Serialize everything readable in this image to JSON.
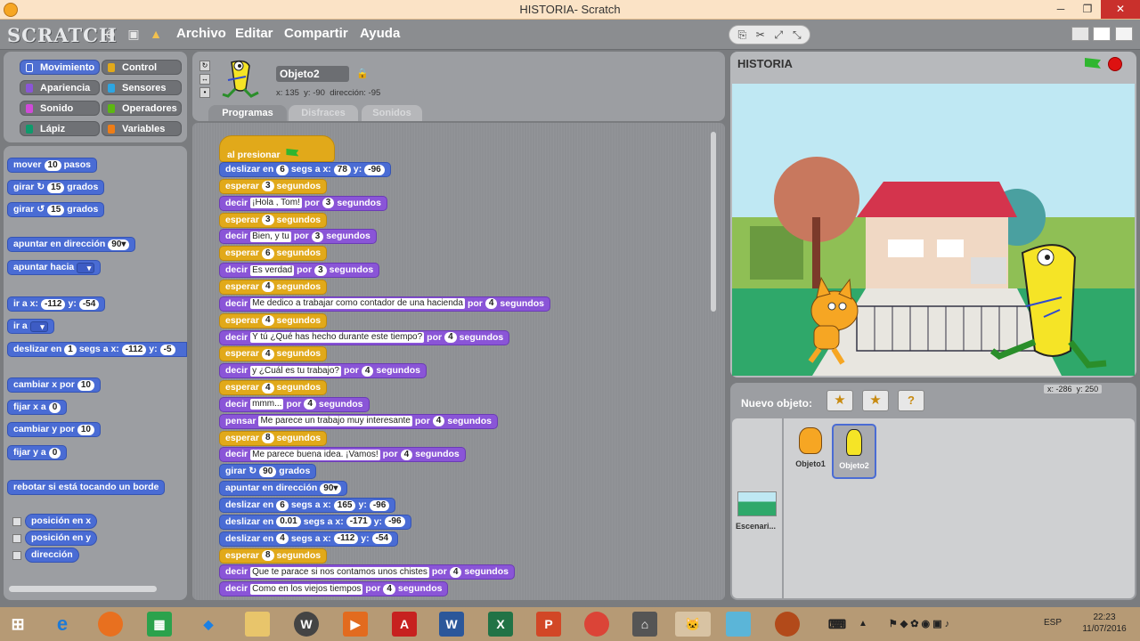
{
  "window": {
    "title": "HISTORIA- Scratch"
  },
  "menu": {
    "logo": "SCRATCH",
    "items": [
      "Archivo",
      "Editar",
      "Compartir",
      "Ayuda"
    ]
  },
  "categories": [
    {
      "label": "Movimiento",
      "color": "#4a6cd4",
      "selected": true
    },
    {
      "label": "Control",
      "color": "#e1a91a",
      "selected": false
    },
    {
      "label": "Apariencia",
      "color": "#8a55d7",
      "selected": false
    },
    {
      "label": "Sensores",
      "color": "#2ca5e2",
      "selected": false
    },
    {
      "label": "Sonido",
      "color": "#cf4ad9",
      "selected": false
    },
    {
      "label": "Operadores",
      "color": "#5cb712",
      "selected": false
    },
    {
      "label": "Lápiz",
      "color": "#0e9a6c",
      "selected": false
    },
    {
      "label": "Variables",
      "color": "#ee7d16",
      "selected": false
    }
  ],
  "palette": {
    "mover": {
      "t1": "mover",
      "v": "10",
      "t2": "pasos"
    },
    "girar_r": {
      "t1": "girar",
      "v": "15",
      "t2": "grados"
    },
    "girar_l": {
      "t1": "girar",
      "v": "15",
      "t2": "grados"
    },
    "apuntar_dir": {
      "t1": "apuntar en dirección",
      "v": "90"
    },
    "apuntar_hacia": {
      "t1": "apuntar hacia"
    },
    "ira_xy": {
      "t1": "ir a x:",
      "x": "-112",
      "t2": "y:",
      "y": "-54"
    },
    "ira": {
      "t1": "ir a"
    },
    "deslizar": {
      "t1": "deslizar en",
      "v": "1",
      "t2": "segs a x:",
      "x": "-112",
      "t3": "y:",
      "y": "-5"
    },
    "cambiar_x": {
      "t1": "cambiar x por",
      "v": "10"
    },
    "fijar_x": {
      "t1": "fijar x a",
      "v": "0"
    },
    "cambiar_y": {
      "t1": "cambiar y por",
      "v": "10"
    },
    "fijar_y": {
      "t1": "fijar y a",
      "v": "0"
    },
    "rebotar": "rebotar si está tocando un borde",
    "reporters": [
      "posición en x",
      "posición en y",
      "dirección"
    ]
  },
  "sprite": {
    "name": "Objeto2",
    "x_label": "x:",
    "x": "135",
    "y_label": "y:",
    "y": "-90",
    "dir_label": "dirección:",
    "dir": "-95"
  },
  "tabs": [
    "Programas",
    "Disfraces",
    "Sonidos"
  ],
  "script": {
    "hat": "al presionar",
    "blocks": [
      {
        "type": "motion",
        "parts": [
          [
            "t",
            "deslizar en"
          ],
          [
            "n",
            "6"
          ],
          [
            "t",
            "segs a x:"
          ],
          [
            "n",
            "78"
          ],
          [
            "t",
            "y:"
          ],
          [
            "n",
            "-96"
          ]
        ]
      },
      {
        "type": "control",
        "parts": [
          [
            "t",
            "esperar"
          ],
          [
            "n",
            "3"
          ],
          [
            "t",
            "segundos"
          ]
        ]
      },
      {
        "type": "looks",
        "parts": [
          [
            "t",
            "decir"
          ],
          [
            "s",
            "¡Hola , Tom!"
          ],
          [
            "t",
            "por"
          ],
          [
            "n",
            "3"
          ],
          [
            "t",
            "segundos"
          ]
        ]
      },
      {
        "type": "control",
        "parts": [
          [
            "t",
            "esperar"
          ],
          [
            "n",
            "3"
          ],
          [
            "t",
            "segundos"
          ]
        ]
      },
      {
        "type": "looks",
        "parts": [
          [
            "t",
            "decir"
          ],
          [
            "s",
            "Bien, y tu"
          ],
          [
            "t",
            "por"
          ],
          [
            "n",
            "3"
          ],
          [
            "t",
            "segundos"
          ]
        ]
      },
      {
        "type": "control",
        "parts": [
          [
            "t",
            "esperar"
          ],
          [
            "n",
            "6"
          ],
          [
            "t",
            "segundos"
          ]
        ]
      },
      {
        "type": "looks",
        "parts": [
          [
            "t",
            "decir"
          ],
          [
            "s",
            "Es verdad"
          ],
          [
            "t",
            "por"
          ],
          [
            "n",
            "3"
          ],
          [
            "t",
            "segundos"
          ]
        ]
      },
      {
        "type": "control",
        "parts": [
          [
            "t",
            "esperar"
          ],
          [
            "n",
            "4"
          ],
          [
            "t",
            "segundos"
          ]
        ]
      },
      {
        "type": "looks",
        "parts": [
          [
            "t",
            "decir"
          ],
          [
            "s",
            "Me dedico a trabajar como contador de una hacienda"
          ],
          [
            "t",
            "por"
          ],
          [
            "n",
            "4"
          ],
          [
            "t",
            "segundos"
          ]
        ]
      },
      {
        "type": "control",
        "parts": [
          [
            "t",
            "esperar"
          ],
          [
            "n",
            "4"
          ],
          [
            "t",
            "segundos"
          ]
        ]
      },
      {
        "type": "looks",
        "parts": [
          [
            "t",
            "decir"
          ],
          [
            "s",
            "Y tú ¿Qué has hecho durante este tiempo?"
          ],
          [
            "t",
            "por"
          ],
          [
            "n",
            "4"
          ],
          [
            "t",
            "segundos"
          ]
        ]
      },
      {
        "type": "control",
        "parts": [
          [
            "t",
            "esperar"
          ],
          [
            "n",
            "4"
          ],
          [
            "t",
            "segundos"
          ]
        ]
      },
      {
        "type": "looks",
        "parts": [
          [
            "t",
            "decir"
          ],
          [
            "s",
            "y ¿Cuál es tu trabajo?"
          ],
          [
            "t",
            "por"
          ],
          [
            "n",
            "4"
          ],
          [
            "t",
            "segundos"
          ]
        ]
      },
      {
        "type": "control",
        "parts": [
          [
            "t",
            "esperar"
          ],
          [
            "n",
            "4"
          ],
          [
            "t",
            "segundos"
          ]
        ]
      },
      {
        "type": "looks",
        "parts": [
          [
            "t",
            "decir"
          ],
          [
            "s",
            "mmm..."
          ],
          [
            "t",
            "por"
          ],
          [
            "n",
            "4"
          ],
          [
            "t",
            "segundos"
          ]
        ]
      },
      {
        "type": "looks",
        "parts": [
          [
            "t",
            "pensar"
          ],
          [
            "s",
            "Me parece un trabajo muy interesante"
          ],
          [
            "t",
            "por"
          ],
          [
            "n",
            "4"
          ],
          [
            "t",
            "segundos"
          ]
        ]
      },
      {
        "type": "control",
        "parts": [
          [
            "t",
            "esperar"
          ],
          [
            "n",
            "8"
          ],
          [
            "t",
            "segundos"
          ]
        ]
      },
      {
        "type": "looks",
        "parts": [
          [
            "t",
            "decir"
          ],
          [
            "s",
            "Me parece buena idea. ¡Vamos!"
          ],
          [
            "t",
            "por"
          ],
          [
            "n",
            "4"
          ],
          [
            "t",
            "segundos"
          ]
        ]
      },
      {
        "type": "motion",
        "parts": [
          [
            "t",
            "girar"
          ],
          [
            "t",
            "↻"
          ],
          [
            "n",
            "90"
          ],
          [
            "t",
            "grados"
          ]
        ]
      },
      {
        "type": "motion",
        "parts": [
          [
            "t",
            "apuntar en dirección"
          ],
          [
            "d",
            "90▾"
          ]
        ]
      },
      {
        "type": "motion",
        "parts": [
          [
            "t",
            "deslizar en"
          ],
          [
            "n",
            "6"
          ],
          [
            "t",
            "segs a x:"
          ],
          [
            "n",
            "165"
          ],
          [
            "t",
            "y:"
          ],
          [
            "n",
            "-96"
          ]
        ]
      },
      {
        "type": "motion",
        "parts": [
          [
            "t",
            "deslizar en"
          ],
          [
            "n",
            "0.01"
          ],
          [
            "t",
            "segs a x:"
          ],
          [
            "n",
            "-171"
          ],
          [
            "t",
            "y:"
          ],
          [
            "n",
            "-96"
          ]
        ]
      },
      {
        "type": "motion",
        "parts": [
          [
            "t",
            "deslizar en"
          ],
          [
            "n",
            "4"
          ],
          [
            "t",
            "segs a x:"
          ],
          [
            "n",
            "-112"
          ],
          [
            "t",
            "y:"
          ],
          [
            "n",
            "-54"
          ]
        ]
      },
      {
        "type": "control",
        "parts": [
          [
            "t",
            "esperar"
          ],
          [
            "n",
            "8"
          ],
          [
            "t",
            "segundos"
          ]
        ]
      },
      {
        "type": "looks",
        "parts": [
          [
            "t",
            "decir"
          ],
          [
            "s",
            "Que te parace si nos contamos unos chistes"
          ],
          [
            "t",
            "por"
          ],
          [
            "n",
            "4"
          ],
          [
            "t",
            "segundos"
          ]
        ]
      },
      {
        "type": "looks",
        "parts": [
          [
            "t",
            "decir"
          ],
          [
            "s",
            "Como en los viejos tiempos"
          ],
          [
            "t",
            "por"
          ],
          [
            "n",
            "4"
          ],
          [
            "t",
            "segundos"
          ]
        ]
      }
    ]
  },
  "stage": {
    "title": "HISTORIA",
    "mouse_x_label": "x:",
    "mouse_x": "-286",
    "mouse_y_label": "y:",
    "mouse_y": "250"
  },
  "new_object": {
    "label": "Nuevo objeto:"
  },
  "sprites": [
    {
      "name": "Objeto1",
      "selected": false
    },
    {
      "name": "Objeto2",
      "selected": true
    }
  ],
  "stage_thumb": {
    "name": "Escenari..."
  },
  "taskbar": {
    "lang": "ESP",
    "time": "22:23",
    "date": "11/07/2016"
  }
}
